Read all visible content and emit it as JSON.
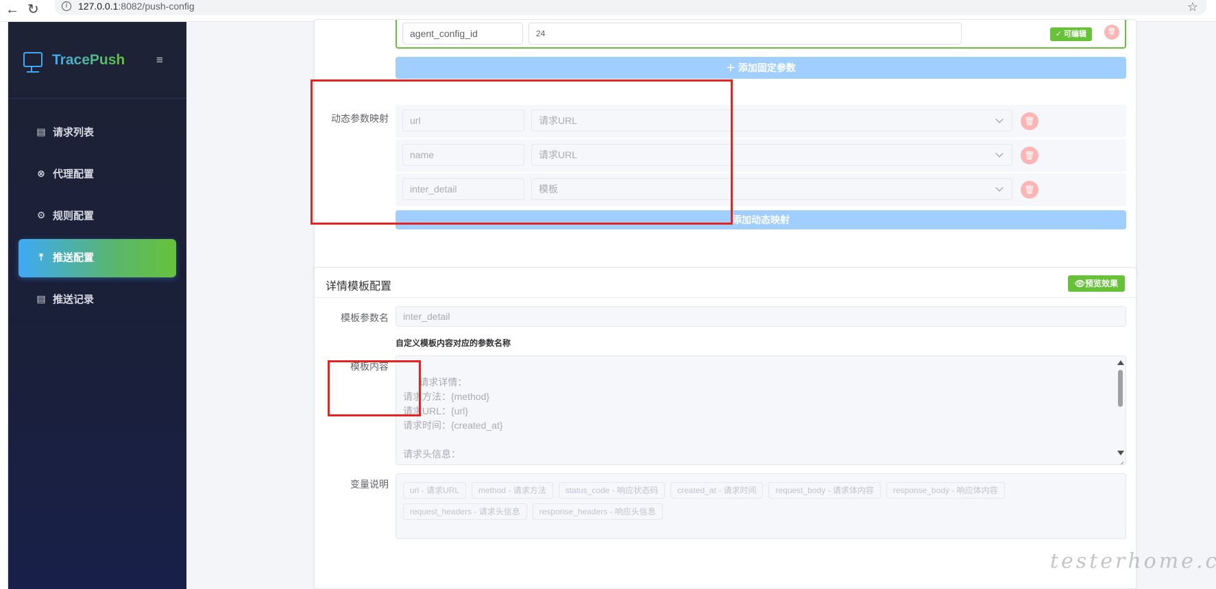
{
  "browser": {
    "url_host": "127.0.0.1",
    "url_rest": ":8082/push-config",
    "back_icon": "←",
    "reload_icon": "↻",
    "star_icon": "☆"
  },
  "sidebar": {
    "brand": "TracePush",
    "toggle_icon": "≡",
    "items": [
      {
        "label": "请求列表",
        "icon": "clipboard-icon",
        "glyph": "▤"
      },
      {
        "label": "代理配置",
        "icon": "link-icon",
        "glyph": "⊗"
      },
      {
        "label": "规则配置",
        "icon": "gear-icon",
        "glyph": "⚙"
      },
      {
        "label": "推送配置",
        "icon": "upload-icon",
        "glyph": "⤒"
      },
      {
        "label": "推送记录",
        "icon": "clipboard-icon",
        "glyph": "▤"
      }
    ]
  },
  "fixed_params": {
    "key": "agent_config_id",
    "value": "24",
    "tag": "✓ 可编辑",
    "add_label": "＋ 添加固定参数",
    "delete_glyph": "🗑"
  },
  "dynamic_params": {
    "label": "动态参数映射",
    "rows": [
      {
        "name": "url",
        "source": "请求URL"
      },
      {
        "name": "name",
        "source": "请求URL"
      },
      {
        "name": "inter_detail",
        "source": "模板"
      }
    ],
    "add_label": "添加动态映射"
  },
  "template_config": {
    "title": "详情模板配置",
    "preview_label": "👁预览效果",
    "param_label": "模板参数名",
    "param_value": "inter_detail",
    "param_hint": "自定义模板内容对应的参数名称",
    "content_label": "模板内容",
    "content": "请求详情：\n请求方法：{method}\n请求URL：{url}\n请求时间：{created_at}\n\n请求头信息：\n{request_headers}\n\n请求体：",
    "vars_label": "变量说明",
    "vars": [
      "url - 请求URL",
      "method - 请求方法",
      "status_code - 响应状态码",
      "created_at - 请求时间",
      "request_body - 请求体内容",
      "response_body - 响应体内容",
      "request_headers - 请求头信息",
      "response_headers - 响应头信息"
    ]
  },
  "watermark": "testerhome.com",
  "colors": {
    "accent_blue": "#3fa9f5",
    "accent_green": "#67c23a",
    "sidebar_bg": "#1e2235",
    "annotation_red": "#e8231f"
  }
}
